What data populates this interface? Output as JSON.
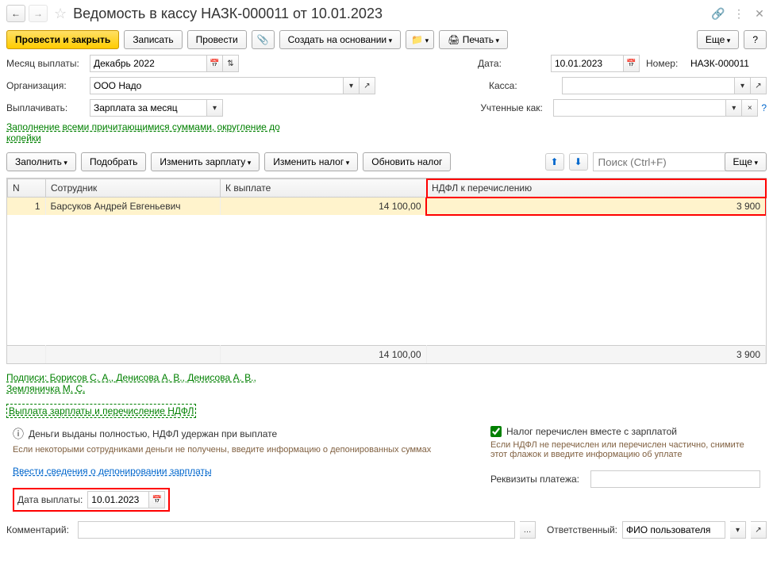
{
  "header": {
    "title": "Ведомость в кассу НАЗК-000011 от 10.01.2023"
  },
  "toolbar": {
    "submit_close": "Провести и закрыть",
    "save": "Записать",
    "submit": "Провести",
    "create_based": "Создать на основании",
    "print": "Печать",
    "more": "Еще",
    "help": "?"
  },
  "fields": {
    "month_label": "Месяц выплаты:",
    "month_value": "Декабрь 2022",
    "date_label": "Дата:",
    "date_value": "10.01.2023",
    "number_label": "Номер:",
    "number_value": "НАЗК-000011",
    "org_label": "Организация:",
    "org_value": "ООО Надо",
    "kassa_label": "Касса:",
    "kassa_value": "",
    "pay_label": "Выплачивать:",
    "pay_value": "Зарплата за месяц",
    "accounted_label": "Учтенные как:",
    "accounted_value": "",
    "fill_link": "Заполнение всеми причитающимися суммами, округление до\nкопейки"
  },
  "toolbar2": {
    "fill": "Заполнить",
    "pick": "Подобрать",
    "change_salary": "Изменить зарплату",
    "change_tax": "Изменить налог",
    "update_tax": "Обновить налог",
    "search_placeholder": "Поиск (Ctrl+F)",
    "more": "Еще"
  },
  "table": {
    "headers": {
      "n": "N",
      "employee": "Сотрудник",
      "to_pay": "К выплате",
      "ndfl": "НДФЛ к перечислению"
    },
    "rows": [
      {
        "n": "1",
        "employee": "Барсуков Андрей Евгеньевич",
        "to_pay": "14 100,00",
        "ndfl": "3 900"
      }
    ],
    "footer": {
      "to_pay": "14 100,00",
      "ndfl": "3 900"
    }
  },
  "info": {
    "signatures": "Подписи: Борисов С. А., Денисова А. В., Денисова А. В.,\nЗемляничка М. С.",
    "payout_link": "Выплата зарплаты и перечисление НДФЛ",
    "money_issued": "Деньги выданы полностью, НДФЛ удержан при выплате",
    "deposit_note": "Если некоторыми сотрудниками деньги не получены, введите информацию о депонированных суммах",
    "deposit_link": "Ввести сведения о депонировании зарплаты",
    "tax_checkbox": "Налог перечислен вместе с зарплатой",
    "ndfl_note": "Если НДФЛ не перечислен или перечислен частично, снимите этот флажок и введите информацию об уплате",
    "payment_details_label": "Реквизиты платежа:",
    "pay_date_label": "Дата выплаты:",
    "pay_date_value": "10.01.2023",
    "comment_label": "Комментарий:",
    "comment_value": "",
    "responsible_label": "Ответственный:",
    "responsible_value": "ФИО пользователя"
  }
}
